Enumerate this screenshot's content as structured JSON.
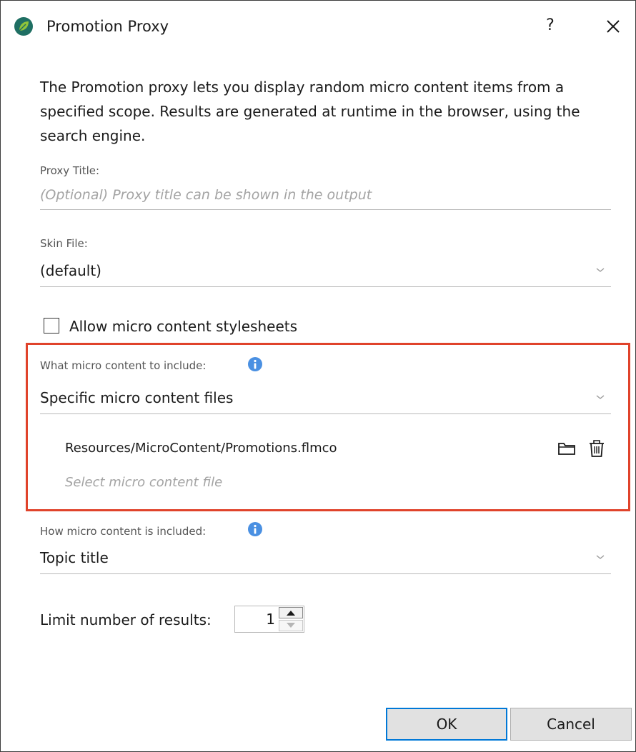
{
  "window": {
    "title": "Promotion Proxy",
    "help_label": "?"
  },
  "icons": {
    "app": "leaf-logo-icon",
    "close": "close-icon",
    "info": "info-icon",
    "chevron": "chevron-down-icon",
    "folder": "folder-icon",
    "trash": "trash-icon",
    "spin_up": "spin-up-arrow-icon",
    "spin_down": "spin-down-arrow-icon"
  },
  "colors": {
    "accent": "#0078d7",
    "highlight_border": "#e0432b",
    "info_blue": "#4a90e2"
  },
  "intro_text": "The Promotion proxy lets you display random micro content items from a specified scope. Results are generated at runtime in the browser, using the search engine.",
  "proxy_title": {
    "label": "Proxy Title:",
    "value": "",
    "placeholder": "(Optional) Proxy title can be shown in the output"
  },
  "skin_file": {
    "label": "Skin File:",
    "value": "(default)"
  },
  "allow_stylesheets": {
    "label": "Allow micro content stylesheets",
    "checked": false
  },
  "include_what": {
    "label": "What micro content to include:",
    "value": "Specific micro content files"
  },
  "files": {
    "items": [
      {
        "path": "Resources/MicroContent/Promotions.flmco"
      }
    ],
    "select_prompt": "Select micro content file"
  },
  "include_how": {
    "label": "How micro content is included:",
    "value": "Topic title"
  },
  "limit_results": {
    "label": "Limit number of results:",
    "value": "1"
  },
  "buttons": {
    "ok": "OK",
    "cancel": "Cancel"
  }
}
